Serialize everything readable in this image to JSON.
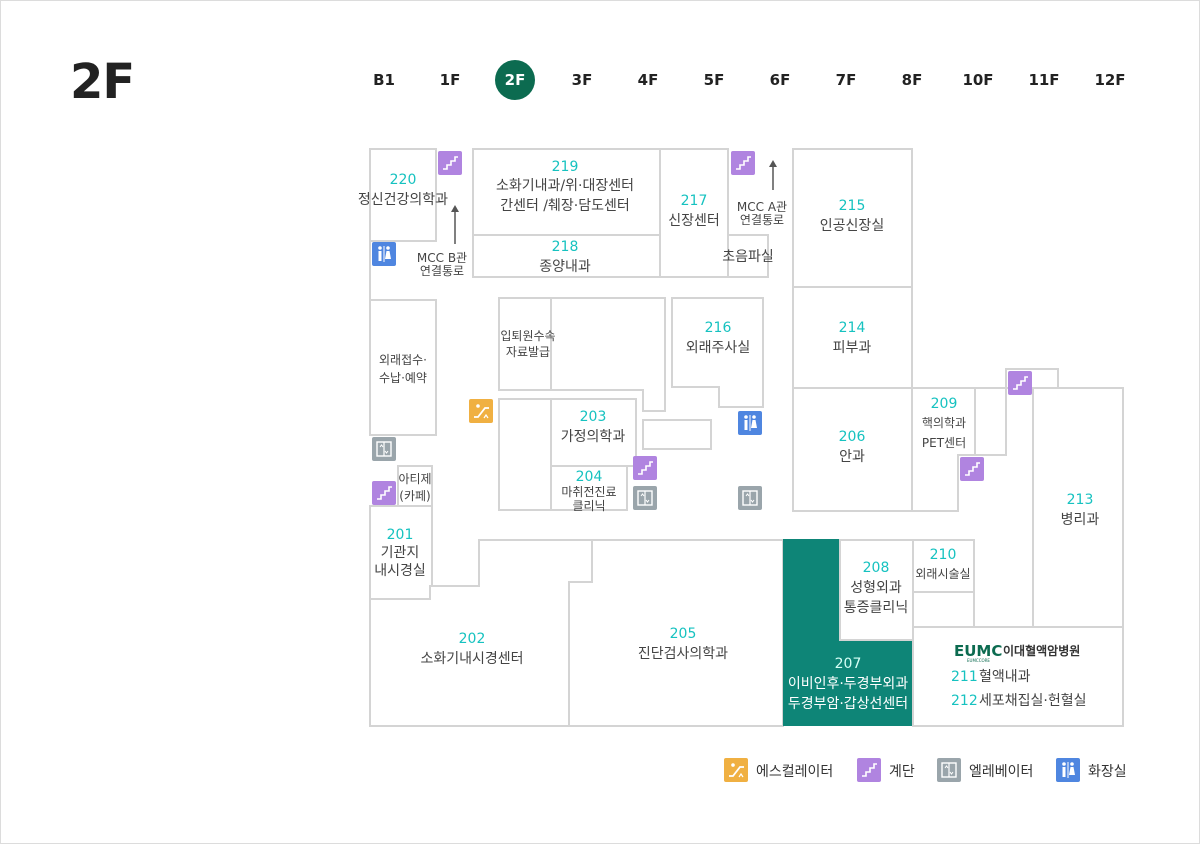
{
  "floor": {
    "title": "2F"
  },
  "floor_tabs": [
    "B1",
    "1F",
    "2F",
    "3F",
    "4F",
    "5F",
    "6F",
    "7F",
    "8F",
    "10F",
    "11F",
    "12F"
  ],
  "active_tab": "2F",
  "rooms": {
    "r220": {
      "num": "220",
      "name": "정신건강의학과"
    },
    "r219": {
      "num": "219",
      "line1": "소화기내과/위·대장센터",
      "line2": "간센터 /췌장·담도센터"
    },
    "r218": {
      "num": "218",
      "name": "종양내과"
    },
    "r217": {
      "num": "217",
      "name": "신장센터"
    },
    "echo": {
      "name": "초음파실"
    },
    "r215": {
      "num": "215",
      "name": "인공신장실"
    },
    "r214": {
      "num": "214",
      "name": "피부과"
    },
    "r216": {
      "num": "216",
      "name": "외래주사실"
    },
    "admission": {
      "line1": "입퇴원수속",
      "line2": "자료발급"
    },
    "outpatient": {
      "line1": "외래접수·",
      "line2": "수납·예약"
    },
    "r203": {
      "num": "203",
      "name": "가정의학과"
    },
    "r204": {
      "num": "204",
      "line1": "마취전진료",
      "line2": "클리닉"
    },
    "r206": {
      "num": "206",
      "name": "안과"
    },
    "r209": {
      "num": "209",
      "line1": "핵의학과",
      "line2": "PET센터"
    },
    "r213": {
      "num": "213",
      "name": "병리과"
    },
    "cafe": {
      "line1": "아티제",
      "line2": "(카페)"
    },
    "r201": {
      "num": "201",
      "line1": "기관지",
      "line2": "내시경실"
    },
    "r202": {
      "num": "202",
      "name": "소화기내시경센터"
    },
    "r205": {
      "num": "205",
      "name": "진단검사의학과"
    },
    "r208": {
      "num": "208",
      "line1": "성형외과",
      "line2": "통증클리닉"
    },
    "r210": {
      "num": "210",
      "name": "외래시술실"
    },
    "r207": {
      "num": "207",
      "line1": "이비인후·두경부외과",
      "line2": "두경부암·갑상선센터"
    },
    "eumc": {
      "logo": "EUMC",
      "logo_sub": "EUMCCORE",
      "brand": "이대혈액암병원"
    },
    "r211": {
      "num": "211",
      "name": "혈액내과"
    },
    "r212": {
      "num": "212",
      "name": "세포채집실·헌혈실"
    }
  },
  "passages": {
    "mcc_a": {
      "line1": "MCC A관",
      "line2": "연결통로"
    },
    "mcc_b": {
      "line1": "MCC B관",
      "line2": "연결통로"
    }
  },
  "legend": [
    {
      "icon": "escalator-icon",
      "label": "에스컬레이터",
      "color": "#f0b042"
    },
    {
      "icon": "stairs-icon",
      "label": "계단",
      "color": "#b084e0"
    },
    {
      "icon": "elevator-icon",
      "label": "엘레베이터",
      "color": "#9aa5ab"
    },
    {
      "icon": "restroom-icon",
      "label": "화장실",
      "color": "#4f86e0"
    }
  ],
  "colors": {
    "active_tab": "#0c6b50",
    "highlight_room": "#0e8577",
    "room_number": "#16c2c0"
  }
}
